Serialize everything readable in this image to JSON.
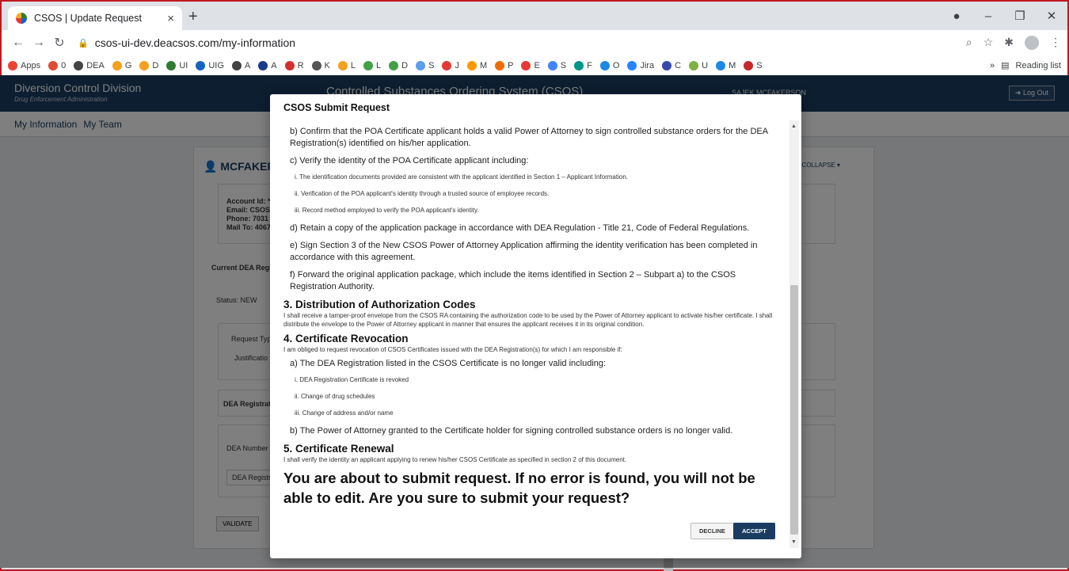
{
  "browser": {
    "tab_title": "CSOS | Update Request",
    "tab_close": "×",
    "new_tab": "+",
    "url_host": "csos-ui-dev.deacsos.com",
    "url_path": "/my-information",
    "bookmarks": [
      {
        "label": "Apps",
        "color": "#ea4335"
      },
      {
        "label": "0",
        "color": "#e04c35"
      },
      {
        "label": "DEA",
        "color": "#444444"
      },
      {
        "label": "G",
        "color": "#f4a020"
      },
      {
        "label": "D",
        "color": "#f4a020"
      },
      {
        "label": "UI",
        "color": "#2f7d32"
      },
      {
        "label": "UIG",
        "color": "#1565c0"
      },
      {
        "label": "A",
        "color": "#444444"
      },
      {
        "label": "A",
        "color": "#1a3a8c"
      },
      {
        "label": "R",
        "color": "#d32f2f"
      },
      {
        "label": "K",
        "color": "#555555"
      },
      {
        "label": "L",
        "color": "#f4a020"
      },
      {
        "label": "L",
        "color": "#43a047"
      },
      {
        "label": "D",
        "color": "#43a047"
      },
      {
        "label": "S",
        "color": "#5c9ded"
      },
      {
        "label": "J",
        "color": "#e53935"
      },
      {
        "label": "M",
        "color": "#ff9800"
      },
      {
        "label": "P",
        "color": "#ef6c00"
      },
      {
        "label": "E",
        "color": "#e53935"
      },
      {
        "label": "S",
        "color": "#4285f4"
      },
      {
        "label": "F",
        "color": "#009688"
      },
      {
        "label": "O",
        "color": "#1e88e5"
      },
      {
        "label": "Jira",
        "color": "#2684ff"
      },
      {
        "label": "C",
        "color": "#3949ab"
      },
      {
        "label": "U",
        "color": "#7cb342"
      },
      {
        "label": "M",
        "color": "#1e88e5"
      },
      {
        "label": "S",
        "color": "#c62828"
      }
    ],
    "more_label": "»",
    "reading_list": "Reading list"
  },
  "app": {
    "org": "Diversion Control Division",
    "org_sub": "Drug Enforcement Administration",
    "center_title": "Controlled Substances Ordering System (CSOS)",
    "user": "SAJEK MCFAKERSON",
    "logout": "Log Out",
    "nav": [
      "My Information",
      "My Team"
    ],
    "card_title": "MCFAKERS",
    "collapse": "COLLAPSE",
    "account_lines": [
      "Account Id: *",
      "Email: CSOS",
      "Phone: 7031",
      "Mail To: 4067"
    ],
    "current_dea": "Current DEA Regis",
    "status": "Status: NEW",
    "request_type": "Request Typ",
    "justification": "Justificatio",
    "dea_registration": "DEA Registrati",
    "dea_number": "DEA Number",
    "dea_regist_field": "DEA Registr",
    "validate": "VALIDATE"
  },
  "modal": {
    "title": "CSOS Submit Request",
    "items": [
      {
        "type": "p",
        "text": "b) Confirm that the POA Certificate applicant holds a valid Power of Attorney to sign controlled substance orders for the DEA Registration(s) identified on his/her application."
      },
      {
        "type": "p",
        "text": "c) Verify the identity of the POA Certificate applicant including:"
      },
      {
        "type": "li",
        "text": "i. The identification documents provided are consistent with the applicant identified in Section 1 – Applicant Information."
      },
      {
        "type": "li",
        "text": "ii. Verification of the POA applicant's identity through a trusted source of employee records."
      },
      {
        "type": "li",
        "text": "iii. Record method employed to verify the POA applicant's identity."
      },
      {
        "type": "p",
        "text": "d) Retain a copy of the application package in accordance with DEA Regulation - Title 21, Code of Federal Regulations."
      },
      {
        "type": "p",
        "text": "e) Sign Section 3 of the New CSOS Power of Attorney Application affirming the identity verification has been completed in accordance with this agreement."
      },
      {
        "type": "p",
        "text": "f) Forward the original application package, which include the items identified in Section 2 – Subpart a) to the CSOS Registration Authority."
      },
      {
        "type": "h",
        "text": "3. Distribution of Authorization Codes"
      },
      {
        "type": "sm",
        "text": "I shall receive a tamper-proof envelope from the CSOS RA containing the authorization code to be used by the Power of Attorney applicant to activate his/her certificate. I shall distribute the envelope to the Power of Attorney applicant in manner that ensures the applicant receives it in its original condition."
      },
      {
        "type": "h",
        "text": "4. Certificate Revocation"
      },
      {
        "type": "sm",
        "text": "I am obliged to request revocation of CSOS Certificates issued with the DEA Registration(s) for which I am responsible if:"
      },
      {
        "type": "p",
        "text": "a) The DEA Registration listed in the CSOS Certificate is no longer valid including:"
      },
      {
        "type": "li",
        "text": "i. DEA Registration Certificate is revoked"
      },
      {
        "type": "li",
        "text": "ii. Change of drug schedules"
      },
      {
        "type": "li",
        "text": "iii. Change of address and/or name"
      },
      {
        "type": "p",
        "text": "b) The Power of Attorney granted to the Certificate holder for signing controlled substance orders is no longer valid."
      },
      {
        "type": "h",
        "text": "5. Certificate Renewal"
      },
      {
        "type": "sm",
        "text": "I shall verify the identity an applicant applying to renew his/her CSOS Certificate as specified in section 2 of this document."
      },
      {
        "type": "warn",
        "text": "You are about to submit request. If no error is found, you will not be able to edit. Are you sure to submit your request?"
      }
    ],
    "decline": "DECLINE",
    "accept": "ACCEPT"
  }
}
